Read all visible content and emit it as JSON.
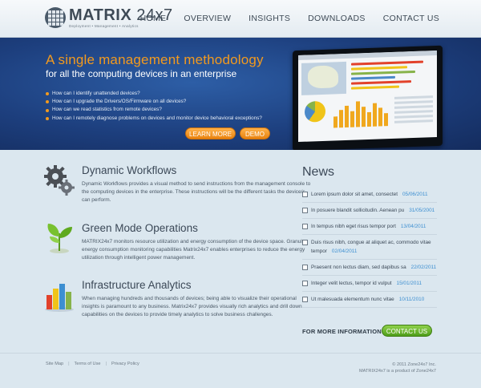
{
  "header": {
    "logo_name": "MATRIX",
    "logo_suffix": "24x7",
    "logo_tagline": "Deployment  •  Management  •  Analytics",
    "nav": [
      "HOME",
      "OVERVIEW",
      "INSIGHTS",
      "DOWNLOADS",
      "CONTACT US"
    ]
  },
  "hero": {
    "title": "A single management methodology",
    "subtitle": "for all the computing devices in an enterprise",
    "bullets": [
      "How can I identify unattended devices?",
      "How can I upgrade the Drivers/OS/Firmware on all devices?",
      "How can we read statistics  from remote devices?",
      "How can I remotely diagnose problems on devices and monitor device behavioral exceptions?"
    ],
    "learn_more": "LEARN MORE",
    "demo": "DEMO"
  },
  "features": [
    {
      "title": "Dynamic Workflows",
      "desc": "Dynamic Workflows provides a visual method to send instructions from the management console to the computing devices in the enterprise. These instructions will be the different tasks the device/s can perform."
    },
    {
      "title": "Green Mode Operations",
      "desc": "MATRIX24x7 monitors resource utilization and energy consumption of the device space. Granular energy consumption monitoring capabilities Matrix24x7 enables enterprises to reduce the energy utilization through intelligent power management."
    },
    {
      "title": "Infrastructure Analytics",
      "desc": "When managing hundreds and thousands of devices; being able to visualize their operational insights is paramount to any business. Matrix24x7 provides visually rich analytics and drill down capabilities on the devices to provide timely analytics to solve business challenges."
    }
  ],
  "news": {
    "title": "News",
    "items": [
      {
        "text": "Lorem ipsum dolor sit amet, consectet",
        "date": "05/06/2011"
      },
      {
        "text": "In posuere blandit sollicitudin. Aenean pu",
        "date": "31/05/2001"
      },
      {
        "text": "In tempus nibh eget risus tempor port",
        "date": "13/04/2011"
      },
      {
        "text": "Duis risus nibh, congue at aliquet ac, commodo vitae tempor",
        "date": "02/04/2011"
      },
      {
        "text": "Praesent non lectus diam, sed dapibus sa",
        "date": "22/02/2011"
      },
      {
        "text": "Integer velit lectus, tempor id vulput",
        "date": "15/01/2011"
      },
      {
        "text": "Ut malesuada elementum nunc vitae",
        "date": "10/11/2010"
      }
    ],
    "more_label": "FOR MORE INFORMATION",
    "contact_button": "CONTACT US"
  },
  "footer": {
    "links": [
      "Site Map",
      "Terms of Use",
      "Privacy Policy"
    ],
    "copyright_line1": "© 2011 Zone24x7 Inc.",
    "copyright_line2": "MATRIX24x7 is a product of Zone24x7"
  },
  "colors": {
    "accent_orange": "#f39a1e",
    "hero_blue": "#1d3f7e",
    "link_blue": "#3d8fd1",
    "green_button": "#4f9e1a"
  }
}
